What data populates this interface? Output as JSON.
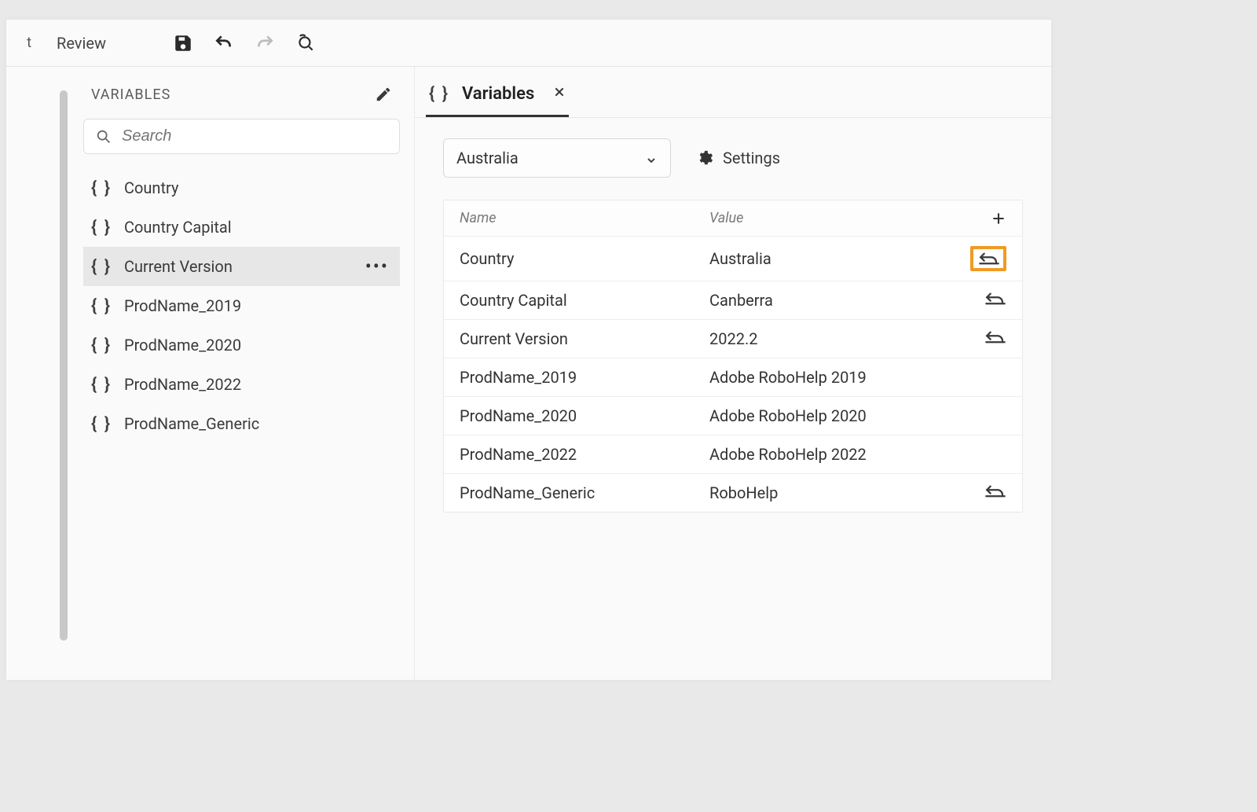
{
  "top": {
    "left_fragment": "t",
    "tab": "Review"
  },
  "sidebar": {
    "title": "VARIABLES",
    "search_placeholder": "Search",
    "items": [
      {
        "label": "Country",
        "selected": false
      },
      {
        "label": "Country Capital",
        "selected": false
      },
      {
        "label": "Current Version",
        "selected": true
      },
      {
        "label": "ProdName_2019",
        "selected": false
      },
      {
        "label": "ProdName_2020",
        "selected": false
      },
      {
        "label": "ProdName_2022",
        "selected": false
      },
      {
        "label": "ProdName_Generic",
        "selected": false
      }
    ]
  },
  "editor": {
    "tab_label": "Variables",
    "dropdown_value": "Australia",
    "settings_label": "Settings",
    "columns": {
      "name": "Name",
      "value": "Value"
    },
    "rows": [
      {
        "name": "Country",
        "value": "Australia",
        "has_reset": true,
        "highlight": true
      },
      {
        "name": "Country Capital",
        "value": "Canberra",
        "has_reset": true,
        "highlight": false
      },
      {
        "name": "Current Version",
        "value": "2022.2",
        "has_reset": true,
        "highlight": false
      },
      {
        "name": "ProdName_2019",
        "value": "Adobe RoboHelp 2019",
        "has_reset": false,
        "highlight": false
      },
      {
        "name": "ProdName_2020",
        "value": "Adobe RoboHelp 2020",
        "has_reset": false,
        "highlight": false
      },
      {
        "name": "ProdName_2022",
        "value": "Adobe RoboHelp 2022",
        "has_reset": false,
        "highlight": false
      },
      {
        "name": "ProdName_Generic",
        "value": "RoboHelp",
        "has_reset": true,
        "highlight": false
      }
    ]
  }
}
